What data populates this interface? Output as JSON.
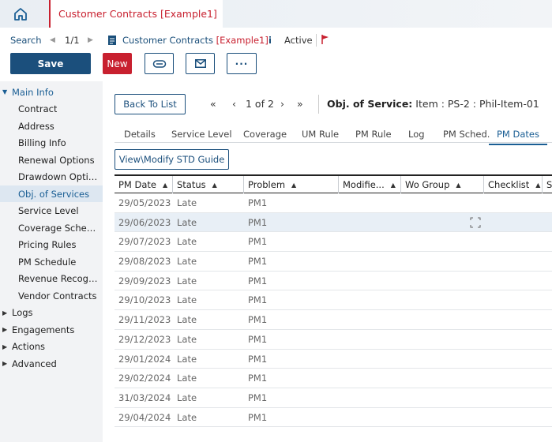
{
  "tab": {
    "title": "Customer Contracts [Example1]"
  },
  "breadcrumb": {
    "search": "Search",
    "prev": "◀",
    "position": "1/1",
    "next": "▶",
    "record_name": "Customer Contracts ",
    "record_suffix": "[Example1]",
    "info": "i",
    "status": "Active"
  },
  "toolbar": {
    "save_label": "Save",
    "new_label": "New",
    "more_label": "···"
  },
  "sidebar": {
    "items": [
      {
        "label": "Main Info",
        "type": "group",
        "expanded": true
      },
      {
        "label": "Contract",
        "type": "child"
      },
      {
        "label": "Address",
        "type": "child"
      },
      {
        "label": "Billing Info",
        "type": "child"
      },
      {
        "label": "Renewal Options",
        "type": "child"
      },
      {
        "label": "Drawdown Options",
        "type": "child"
      },
      {
        "label": "Obj. of Services",
        "type": "child",
        "selected": true
      },
      {
        "label": "Service Level",
        "type": "child"
      },
      {
        "label": "Coverage Schedule",
        "type": "child"
      },
      {
        "label": "Pricing Rules",
        "type": "child"
      },
      {
        "label": "PM Schedule",
        "type": "child"
      },
      {
        "label": "Revenue Recogniti...",
        "type": "child"
      },
      {
        "label": "Vendor Contracts",
        "type": "child"
      },
      {
        "label": "Logs",
        "type": "group"
      },
      {
        "label": "Engagements",
        "type": "group"
      },
      {
        "label": "Actions",
        "type": "group"
      },
      {
        "label": "Advanced",
        "type": "group"
      }
    ]
  },
  "pager": {
    "back_label": "Back To List",
    "first": "«",
    "prev": "‹",
    "info": "1 of 2",
    "next": "›",
    "last": "»",
    "object_label": "Obj. of Service:",
    "object_value": " Item : PS-2 : Phil-Item-01"
  },
  "subtabs": [
    "Details",
    "Service Level",
    "Coverage",
    "UM Rule",
    "PM Rule",
    "Log",
    "PM Sched.",
    "PM Dates"
  ],
  "active_subtab": "PM Dates",
  "std_button_label": "View\\Modify STD Guide",
  "grid": {
    "columns": [
      "PM Date",
      "Status",
      "Problem",
      "Modifie...",
      "Wo Group",
      "Checklist",
      "S"
    ],
    "rows": [
      [
        "29/05/2023",
        "Late",
        "PM1"
      ],
      [
        "29/06/2023",
        "Late",
        "PM1"
      ],
      [
        "29/07/2023",
        "Late",
        "PM1"
      ],
      [
        "29/08/2023",
        "Late",
        "PM1"
      ],
      [
        "29/09/2023",
        "Late",
        "PM1"
      ],
      [
        "29/10/2023",
        "Late",
        "PM1"
      ],
      [
        "29/11/2023",
        "Late",
        "PM1"
      ],
      [
        "29/12/2023",
        "Late",
        "PM1"
      ],
      [
        "29/01/2024",
        "Late",
        "PM1"
      ],
      [
        "29/02/2024",
        "Late",
        "PM1"
      ],
      [
        "31/03/2024",
        "Late",
        "PM1"
      ],
      [
        "29/04/2024",
        "Late",
        "PM1"
      ]
    ],
    "highlighted_row": 1
  },
  "colors": {
    "brand": "#1b4f7c",
    "accent": "#c8202f",
    "link": "#1a5e94"
  }
}
